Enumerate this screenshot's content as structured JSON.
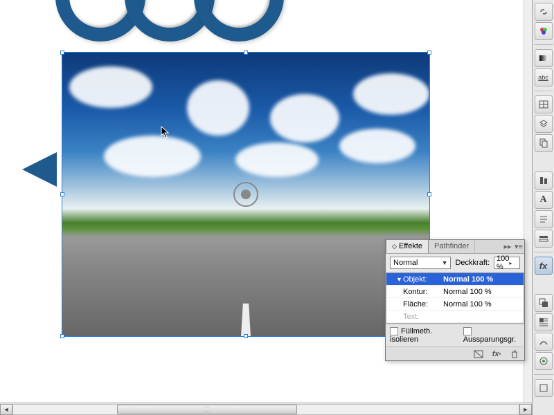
{
  "panel": {
    "tabs": {
      "effects": "Effekte",
      "pathfinder": "Pathfinder"
    },
    "blend_mode": "Normal",
    "opacity_label": "Deckkraft:",
    "opacity_value": "100 %",
    "targets": {
      "object": {
        "label": "Objekt:",
        "value": "Normal 100 %"
      },
      "stroke": {
        "label": "Kontur:",
        "value": "Normal 100 %"
      },
      "fill": {
        "label": "Fläche:",
        "value": "Normal 100 %"
      },
      "text": {
        "label": "Text:",
        "value": ""
      }
    },
    "isolate_label": "Füllmeth. isolieren",
    "knockout_label": "Aussparungsgr."
  },
  "dock_icons": [
    "links-icon",
    "swatches-icon",
    "gradient-icon",
    "character-icon",
    "table-icon",
    "layers-icon",
    "pages-icon",
    "align-icon",
    "paragraph-styles-icon",
    "character-styles-icon",
    "object-styles-icon",
    "effects-icon",
    "pathfinder-icon",
    "text-wrap-icon",
    "scripts-icon",
    "preflight-icon",
    "info-icon"
  ]
}
